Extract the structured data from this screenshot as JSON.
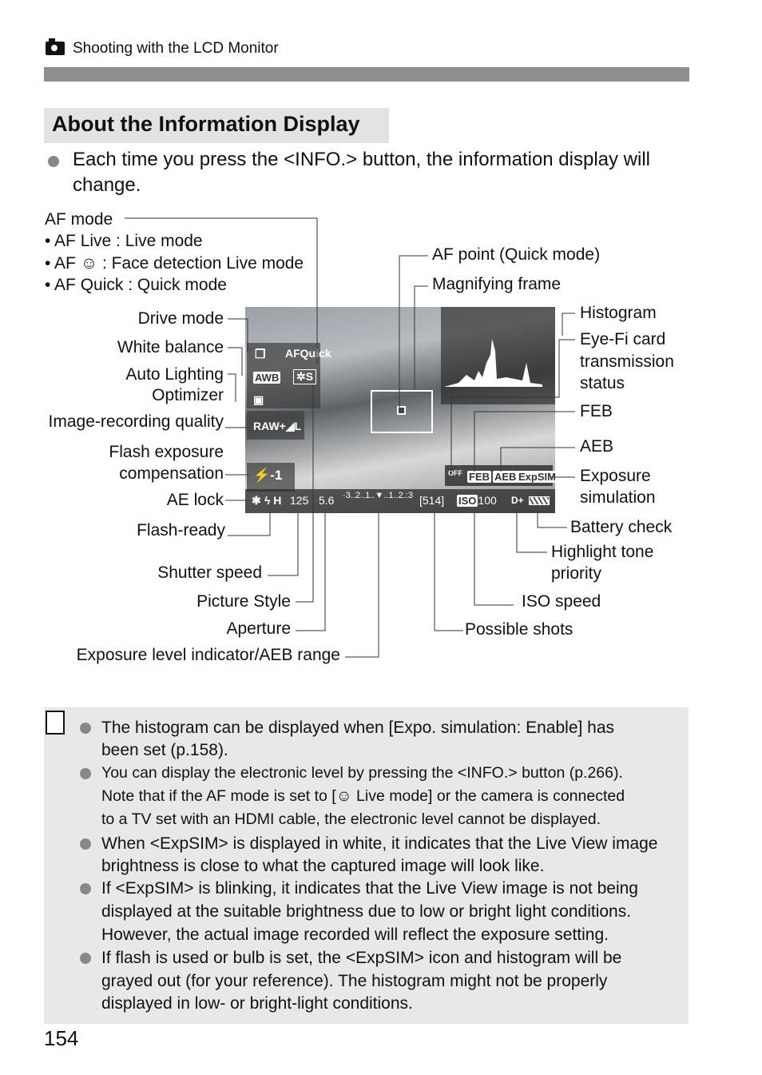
{
  "header": {
    "icon": "camera-icon",
    "title": "Shooting with the LCD Monitor"
  },
  "section_title": "About the Information Display",
  "intro": {
    "line1": "Each time you press the <INFO.> button, the information display will",
    "line2": "change."
  },
  "af_mode": {
    "title": "AF mode",
    "items": [
      "• AF Live : Live mode",
      "• AF ☺ : Face detection Live mode",
      "• AF Quick : Quick mode"
    ]
  },
  "left_labels": {
    "drive": "Drive mode",
    "wb": "White balance",
    "alo1": "Auto Lighting",
    "alo2": "Optimizer",
    "quality": "Image-recording quality",
    "fec1": "Flash exposure",
    "fec2": "compensation",
    "ae_lock": "AE lock",
    "flash_ready": "Flash-ready",
    "shutter": "Shutter speed",
    "style": "Picture Style",
    "aperture": "Aperture",
    "exposure": "Exposure level indicator/AEB range"
  },
  "right_labels": {
    "af_point": "AF point (Quick mode)",
    "magnify": "Magnifying frame",
    "histogram": "Histogram",
    "eyefi1": "Eye-Fi card",
    "eyefi2": "transmission",
    "eyefi3": "status",
    "feb": "FEB",
    "aeb": "AEB",
    "expsim1": "Exposure",
    "expsim2": "simulation",
    "battery": "Battery check",
    "htp1": "Highlight tone",
    "htp2": "priority",
    "iso": "ISO speed",
    "shots": "Possible shots"
  },
  "screen": {
    "af": "AFQuick",
    "awb": "AWB",
    "raw": "RAW+◢L",
    "fec": "-1",
    "ae": "✱",
    "flash": "ϟ H",
    "shutter": "125",
    "aperture": "5.6",
    "scale": "·3..2..1..▼..1..2.:3",
    "shots": "[514]",
    "iso": "100",
    "iso_label": "ISO",
    "dplus": "D+",
    "feb": "FEB",
    "aeb": "AEB",
    "expsim": "ExpSIM",
    "eyefi": "OFF"
  },
  "notes": {
    "icon": "memo-pencil-icon",
    "lines": [
      "The histogram can be displayed when [Expo. simulation: Enable] has",
      "been set (p.158).",
      "You can display the electronic level by pressing the <INFO.> button (p.266).",
      "Note that if the AF mode is set to [☺ Live mode] or the camera is connected",
      "to a TV set with an HDMI cable, the electronic level cannot be displayed.",
      "When <ExpSIM> is displayed in white, it indicates that the Live View image",
      "brightness is close to what the captured image will look like.",
      "If <ExpSIM> is blinking, it indicates that the Live View image is not being",
      "displayed at the suitable brightness due to low or bright light conditions.",
      "However, the actual image recorded will reflect the exposure setting.",
      "If flash is used or bulb is set, the <ExpSIM> icon and histogram will be",
      "grayed out (for your reference). The histogram might not be properly",
      "displayed in low- or bright-light conditions."
    ]
  },
  "page_number": "154"
}
